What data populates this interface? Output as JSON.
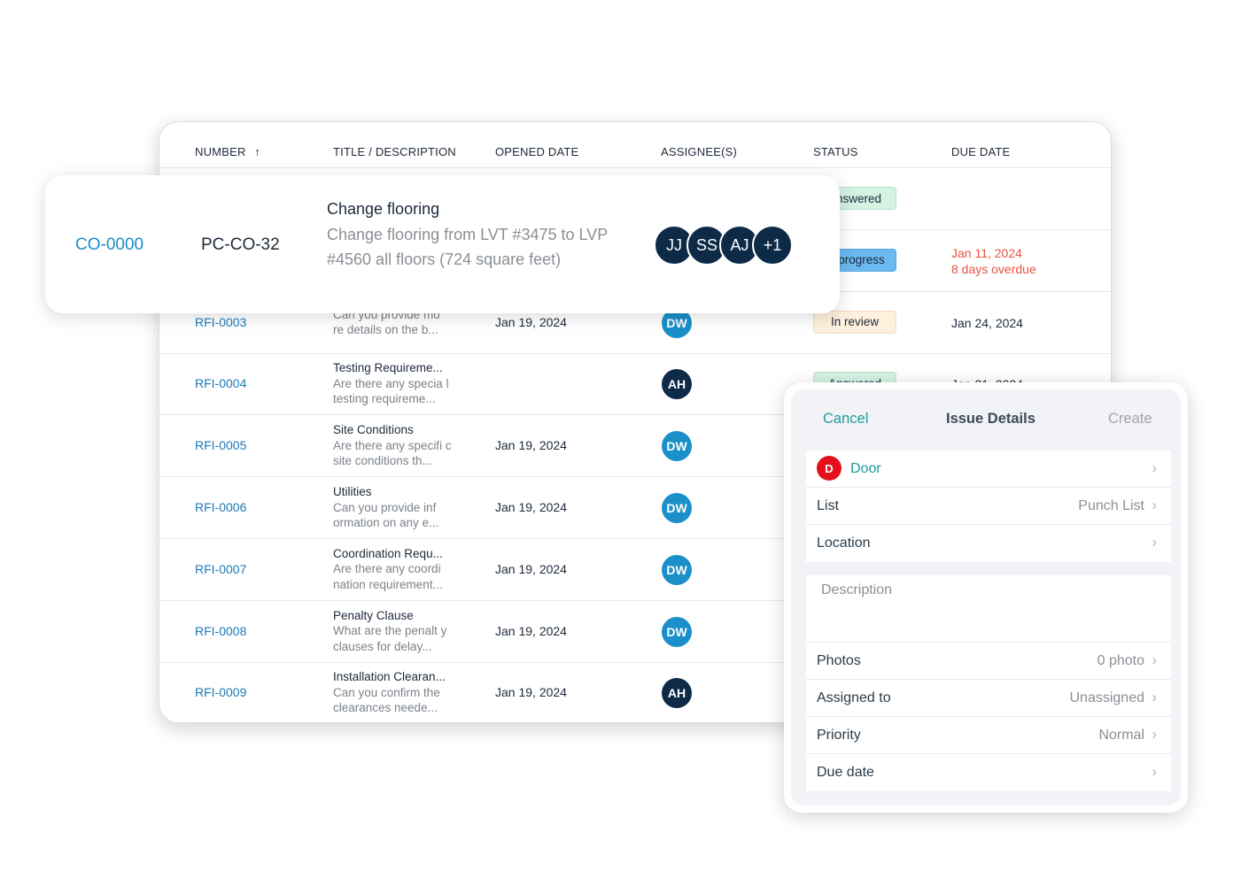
{
  "table": {
    "headers": {
      "number": "NUMBER",
      "title": "TITLE / DESCRIPTION",
      "opened": "OPENED DATE",
      "assignees": "ASSIGNEE(S)",
      "status": "STATUS",
      "due": "DUE DATE"
    },
    "sort_icon": "arrow-up-icon",
    "rows": [
      {
        "number": "",
        "title": "",
        "desc": "",
        "opened": "",
        "assignee": "",
        "status": "Answered",
        "due": "",
        "overdue": ""
      },
      {
        "number": "",
        "title": "",
        "desc": "",
        "opened": "",
        "assignee": "",
        "status": "In progress",
        "due": "Jan 11, 2024",
        "overdue": "8 days overdue"
      },
      {
        "number": "RFI-0003",
        "title": "",
        "desc": "Can you provide mo re details on the b...",
        "opened": "Jan 19, 2024",
        "assignee": "DW",
        "status": "In review",
        "due": "Jan 24, 2024",
        "overdue": ""
      },
      {
        "number": "RFI-0004",
        "title": "Testing Requireme...",
        "desc": "Are there any specia l testing requireme...",
        "opened": "",
        "assignee": "AH",
        "status": "Answered",
        "due": "Jan 21, 2024",
        "overdue": ""
      },
      {
        "number": "RFI-0005",
        "title": "Site Conditions",
        "desc": "Are there any specifi c site conditions th...",
        "opened": "Jan 19, 2024",
        "assignee": "DW",
        "status": "",
        "due": "",
        "overdue": ""
      },
      {
        "number": "RFI-0006",
        "title": "Utilities",
        "desc": "Can you provide inf ormation on any e...",
        "opened": "Jan 19, 2024",
        "assignee": "DW",
        "status": "",
        "due": "",
        "overdue": ""
      },
      {
        "number": "RFI-0007",
        "title": "Coordination Requ...",
        "desc": "Are there any coordi nation requirement...",
        "opened": "Jan 19, 2024",
        "assignee": "DW",
        "status": "",
        "due": "",
        "overdue": ""
      },
      {
        "number": "RFI-0008",
        "title": "Penalty Clause",
        "desc": "What are the penalt y clauses for delay...",
        "opened": "Jan 19, 2024",
        "assignee": "DW",
        "status": "",
        "due": "",
        "overdue": ""
      },
      {
        "number": "RFI-0009",
        "title": "Installation Clearan...",
        "desc": "Can you confirm the clearances neede...",
        "opened": "Jan 19, 2024",
        "assignee": "AH",
        "status": "",
        "due": "",
        "overdue": ""
      }
    ]
  },
  "colors": {
    "DW": "#1a8fc9",
    "AH": "#0d2a47",
    "Answered": "#d5f2e3",
    "In progress": "#6bb9ef",
    "In review": "#fdf0dc",
    "overdue": "#e5533d"
  },
  "card": {
    "number": "CO-0000",
    "ref": "PC-CO-32",
    "title": "Change flooring",
    "desc": "Change flooring from LVT #3475 to LVP #4560 all floors (724 square feet)",
    "assignees": [
      "JJ",
      "SS",
      "AJ",
      "+1"
    ]
  },
  "panel": {
    "cancel": "Cancel",
    "title": "Issue Details",
    "create": "Create",
    "type_badge": "D",
    "type": "Door",
    "list_label": "List",
    "list_value": "Punch List",
    "location_label": "Location",
    "description_placeholder": "Description",
    "photos_label": "Photos",
    "photos_value": "0 photo",
    "assigned_label": "Assigned to",
    "assigned_value": "Unassigned",
    "priority_label": "Priority",
    "priority_value": "Normal",
    "due_label": "Due date",
    "chevron_icon": "chevron-right-icon"
  }
}
